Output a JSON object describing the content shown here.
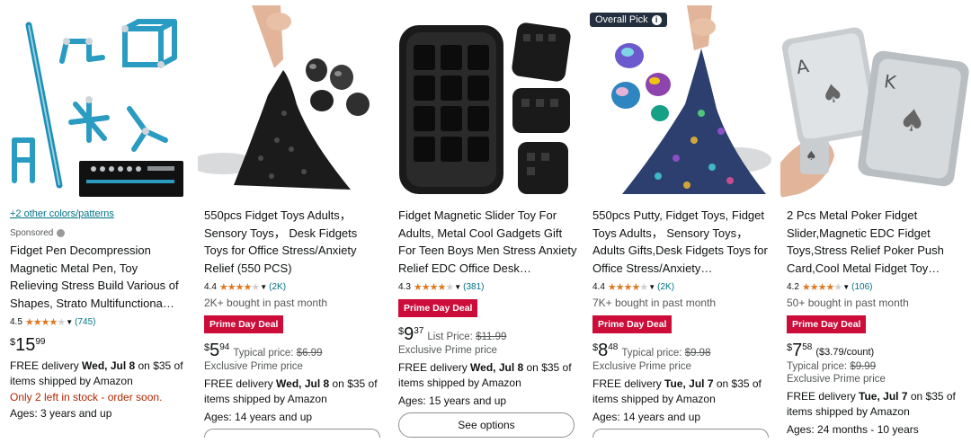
{
  "cards": [
    {
      "swatch_link": "+2 other colors/patterns",
      "sponsored": "Sponsored",
      "title": "Fidget Pen Decompression Magnetic Metal Pen, Toy Relieving Stress Build Various of Shapes, Strato Multifunctiona…",
      "rating": "4.5",
      "rating_value": 4.5,
      "review_count": "(745)",
      "price_currency": "$",
      "price_whole": "15",
      "price_fraction": "99",
      "delivery_prefix": "FREE delivery ",
      "delivery_date": "Wed, Jul 8",
      "delivery_suffix": " on $35 of items shipped by Amazon",
      "stock": "Only 2 left in stock - order soon.",
      "ages": "Ages: 3 years and up"
    },
    {
      "title": "550pcs Fidget Toys Adults， Sensory Toys， Desk Fidgets Toys for Office Stress/Anxiety Relief (550 PCS)",
      "rating": "4.4",
      "rating_value": 4.4,
      "review_count": "(2K)",
      "bought": "2K+ bought in past month",
      "deal": "Prime Day Deal",
      "price_currency": "$",
      "price_whole": "5",
      "price_fraction": "94",
      "typical_label": "Typical price: ",
      "typical_price": "$6.99",
      "exclusive": "Exclusive Prime price",
      "delivery_prefix": "FREE delivery ",
      "delivery_date": "Wed, Jul 8",
      "delivery_suffix": " on $35 of items shipped by Amazon",
      "ages": "Ages: 14 years and up"
    },
    {
      "title": "Fidget Magnetic Slider Toy For Adults, Metal Cool Gadgets Gift For Teen Boys Men Stress Anxiety Relief EDC Office Desk…",
      "rating": "4.3",
      "rating_value": 4.3,
      "review_count": "(381)",
      "deal": "Prime Day Deal",
      "price_currency": "$",
      "price_whole": "9",
      "price_fraction": "37",
      "typical_label": "List Price: ",
      "typical_price": "$11.99",
      "exclusive": "Exclusive Prime price",
      "delivery_prefix": "FREE delivery ",
      "delivery_date": "Wed, Jul 8",
      "delivery_suffix": " on $35 of items shipped by Amazon",
      "ages": "Ages: 15 years and up",
      "button": "See options"
    },
    {
      "badge": "Overall Pick",
      "title": "550pcs Putty, Fidget Toys, Fidget Toys Adults， Sensory Toys， Adults Gifts,Desk Fidgets Toys for Office Stress/Anxiety…",
      "rating": "4.4",
      "rating_value": 4.4,
      "review_count": "(2K)",
      "bought": "7K+ bought in past month",
      "deal": "Prime Day Deal",
      "price_currency": "$",
      "price_whole": "8",
      "price_fraction": "48",
      "typical_label": "Typical price: ",
      "typical_price": "$9.98",
      "exclusive": "Exclusive Prime price",
      "delivery_prefix": "FREE delivery ",
      "delivery_date": "Tue, Jul 7",
      "delivery_suffix": " on $35 of items shipped by Amazon",
      "ages": "Ages: 14 years and up"
    },
    {
      "title": "2 Pcs Metal Poker Fidget Slider,Magnetic EDC Fidget Toys,Stress Relief Poker Push Card,Cool Metal Fidget Toy…",
      "rating": "4.2",
      "rating_value": 4.2,
      "review_count": "(106)",
      "bought": "50+ bought in past month",
      "deal": "Prime Day Deal",
      "price_currency": "$",
      "price_whole": "7",
      "price_fraction": "58",
      "per_count": "($3.79/count)",
      "typical_label": "Typical price: ",
      "typical_price": "$9.99",
      "exclusive": "Exclusive Prime price",
      "delivery_prefix": "FREE delivery ",
      "delivery_date": "Tue, Jul 7",
      "delivery_suffix": " on $35 of items shipped by Amazon",
      "ages": "Ages: 24 months - 10 years"
    }
  ],
  "colors": {
    "deal": "#cc0c39",
    "link": "#007185",
    "star": "#de7921",
    "stock": "#b12704",
    "badge": "#232f3e"
  }
}
